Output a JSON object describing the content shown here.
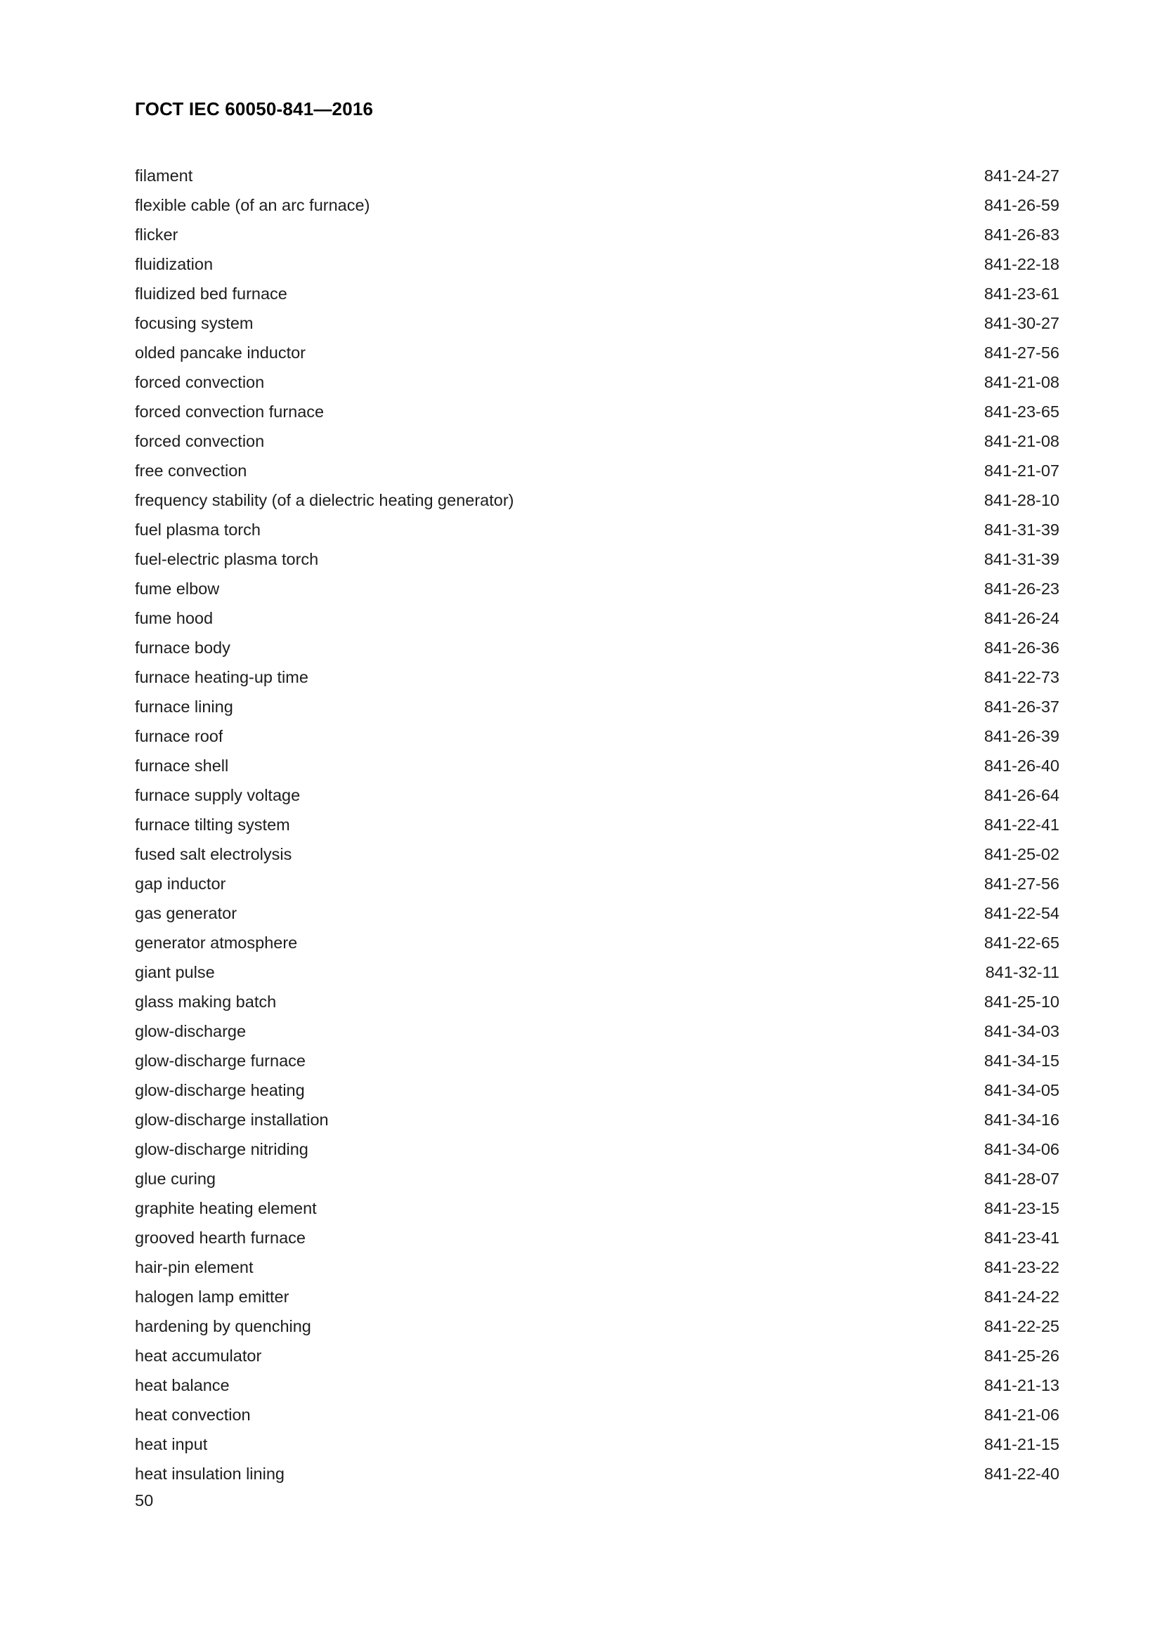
{
  "document": {
    "header": "ГОСТ IEC 60050-841—2016",
    "page_number": "50"
  },
  "index": {
    "entries": [
      {
        "term": "filament",
        "code": "841-24-27"
      },
      {
        "term": "flexible cable (of an arc furnace)",
        "code": "841-26-59"
      },
      {
        "term": "flicker",
        "code": "841-26-83"
      },
      {
        "term": "fluidization",
        "code": "841-22-18"
      },
      {
        "term": "fluidized bed furnace",
        "code": "841-23-61"
      },
      {
        "term": "focusing system",
        "code": "841-30-27"
      },
      {
        "term": "olded pancake inductor",
        "code": "841-27-56"
      },
      {
        "term": "forced convection",
        "code": "841-21-08"
      },
      {
        "term": "forced convection furnace",
        "code": "841-23-65"
      },
      {
        "term": "forced convection",
        "code": "841-21-08"
      },
      {
        "term": "free convection",
        "code": "841-21-07"
      },
      {
        "term": "frequency stability (of a dielectric heating generator)",
        "code": "841-28-10"
      },
      {
        "term": "fuel plasma torch",
        "code": "841-31-39"
      },
      {
        "term": "fuel-electric plasma torch",
        "code": "841-31-39"
      },
      {
        "term": "fume elbow",
        "code": "841-26-23"
      },
      {
        "term": "fume hood",
        "code": "841-26-24"
      },
      {
        "term": "furnace body",
        "code": "841-26-36"
      },
      {
        "term": "furnace heating-up time",
        "code": "841-22-73"
      },
      {
        "term": "furnace lining",
        "code": "841-26-37"
      },
      {
        "term": "furnace roof",
        "code": "841-26-39"
      },
      {
        "term": "furnace shell",
        "code": "841-26-40"
      },
      {
        "term": "furnace supply voltage",
        "code": "841-26-64"
      },
      {
        "term": "furnace tilting system",
        "code": "841-22-41"
      },
      {
        "term": "fused salt electrolysis",
        "code": "841-25-02"
      },
      {
        "term": "gap inductor",
        "code": "841-27-56"
      },
      {
        "term": "gas generator",
        "code": "841-22-54"
      },
      {
        "term": "generator atmosphere",
        "code": "841-22-65"
      },
      {
        "term": "giant pulse",
        "code": "841-32-11"
      },
      {
        "term": "glass making batch",
        "code": "841-25-10"
      },
      {
        "term": "glow-discharge",
        "code": "841-34-03"
      },
      {
        "term": "glow-discharge furnace",
        "code": "841-34-15"
      },
      {
        "term": "glow-discharge heating",
        "code": "841-34-05"
      },
      {
        "term": "glow-discharge installation",
        "code": "841-34-16"
      },
      {
        "term": "glow-discharge nitriding",
        "code": "841-34-06"
      },
      {
        "term": "glue curing",
        "code": "841-28-07"
      },
      {
        "term": "graphite heating element",
        "code": "841-23-15"
      },
      {
        "term": "grooved hearth furnace",
        "code": "841-23-41"
      },
      {
        "term": "hair-pin element",
        "code": "841-23-22"
      },
      {
        "term": "halogen lamp emitter",
        "code": "841-24-22"
      },
      {
        "term": "hardening by quenching",
        "code": "841-22-25"
      },
      {
        "term": "heat accumulator",
        "code": "841-25-26"
      },
      {
        "term": "heat balance",
        "code": "841-21-13"
      },
      {
        "term": "heat convection",
        "code": "841-21-06"
      },
      {
        "term": "heat input",
        "code": "841-21-15"
      },
      {
        "term": "heat insulation lining",
        "code": "841-22-40"
      }
    ]
  }
}
